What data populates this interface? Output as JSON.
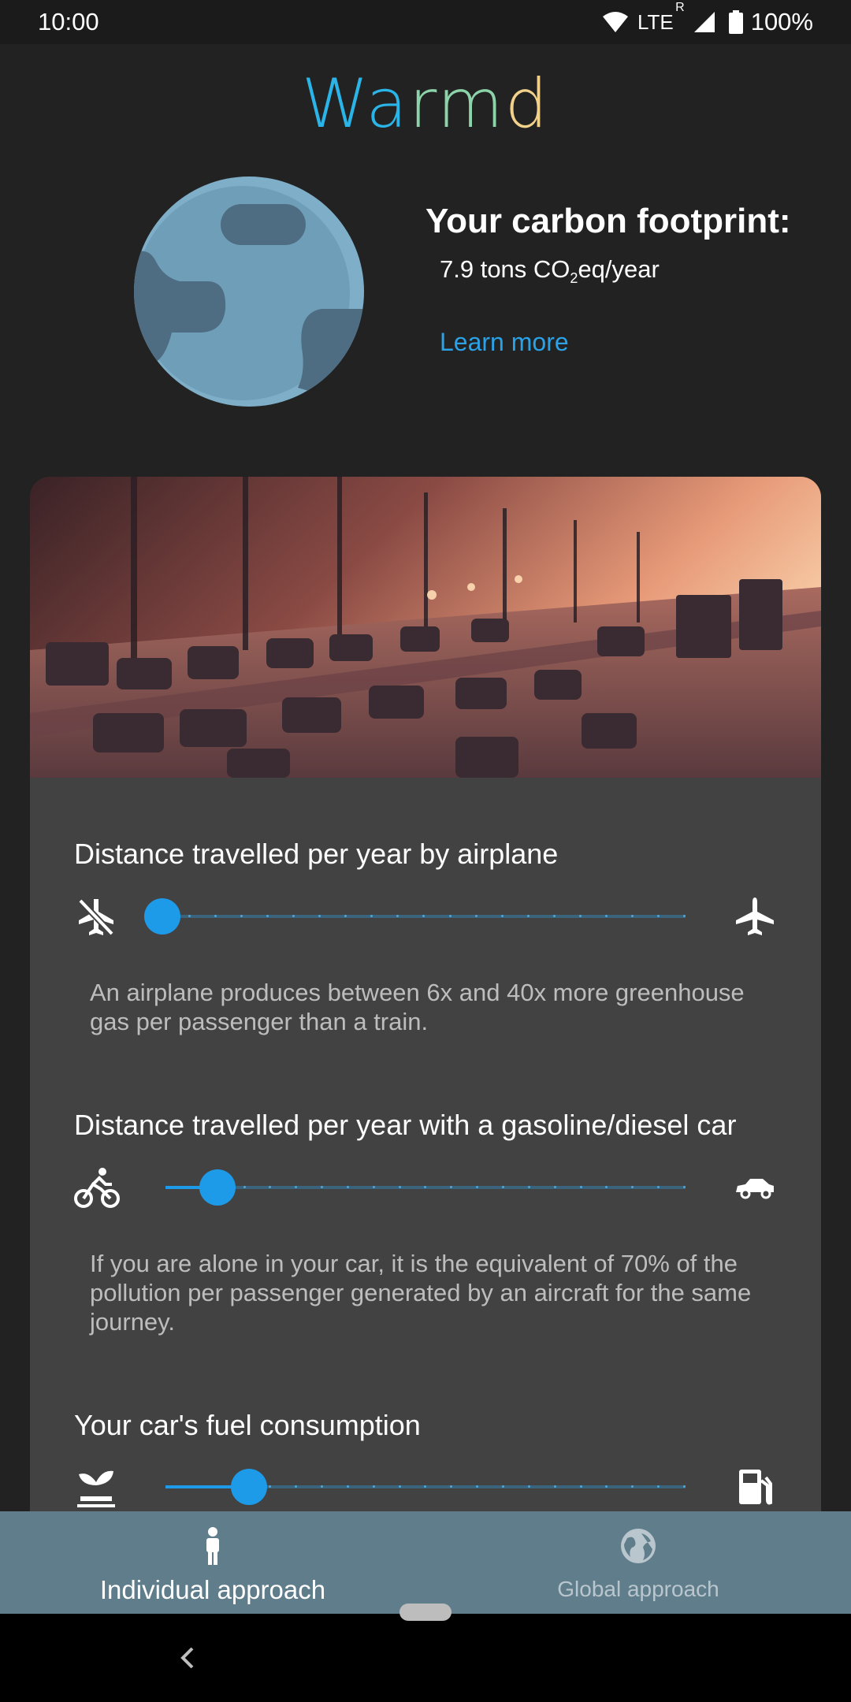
{
  "status_bar": {
    "time": "10:00",
    "network": "LTE",
    "roaming": "R",
    "battery": "100%"
  },
  "app": {
    "title_parts": [
      "Wa",
      "rm",
      "d"
    ],
    "accent_colors": [
      "#2ab4e8",
      "#8cd3a9",
      "#f2d28b"
    ]
  },
  "footprint": {
    "title": "Your carbon footprint:",
    "value_prefix": "7.9 tons CO",
    "value_sub": "2",
    "value_suffix": "eq/year",
    "learn_more": "Learn more"
  },
  "card": {
    "image_icon": "highway-traffic-sunset-image",
    "sections": [
      {
        "title": "Distance travelled per year by airplane",
        "left_icon": "no-flight-icon",
        "right_icon": "airplane-icon",
        "value_fraction": 0.0,
        "description": "An airplane produces between 6x and 40x more greenhouse gas per passenger than a train."
      },
      {
        "title": "Distance travelled per year with a gasoline/diesel car",
        "left_icon": "bicycle-icon",
        "right_icon": "car-icon",
        "value_fraction": 0.1,
        "description": "If you are alone in your car, it is the equivalent of 70% of the pollution per passenger generated by an aircraft for the same journey."
      },
      {
        "title": "Your car's fuel consumption",
        "left_icon": "seedling-icon",
        "right_icon": "fuel-pump-icon",
        "value_fraction": 0.16,
        "description": ""
      }
    ]
  },
  "bottom_nav": {
    "items": [
      {
        "label": "Individual approach",
        "icon": "person-icon",
        "active": true
      },
      {
        "label": "Global approach",
        "icon": "globe-icon",
        "active": false
      }
    ]
  },
  "colors": {
    "background": "#222222",
    "card": "#424242",
    "accent": "#1e9be8",
    "bottom_nav": "#607d8b"
  }
}
